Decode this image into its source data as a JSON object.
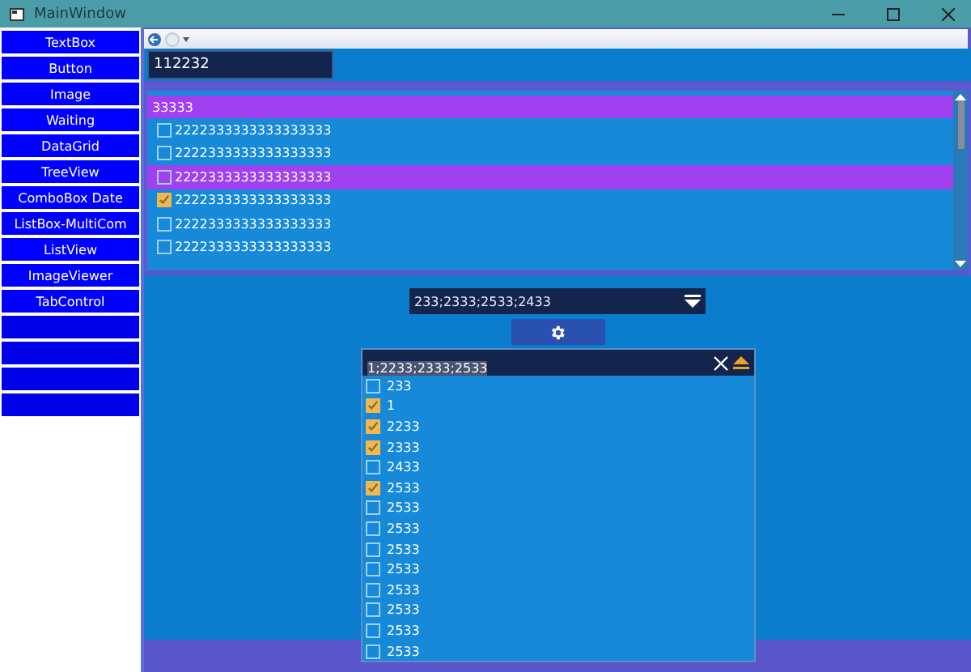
{
  "window": {
    "title": "MainWindow"
  },
  "sidebar": {
    "items": [
      {
        "label": "TextBox",
        "disabled": false
      },
      {
        "label": "Button",
        "disabled": false
      },
      {
        "label": "Image",
        "disabled": false
      },
      {
        "label": "Waiting",
        "disabled": false
      },
      {
        "label": "DataGrid",
        "disabled": false
      },
      {
        "label": "TreeView",
        "disabled": false
      },
      {
        "label": "ComboBox Date",
        "disabled": false
      },
      {
        "label": "ListBox-MultiCom",
        "disabled": false
      },
      {
        "label": "ListView",
        "disabled": false
      },
      {
        "label": "ImageViewer",
        "disabled": false
      },
      {
        "label": "TabControl",
        "disabled": false
      },
      {
        "disabled": true
      },
      {
        "disabled": true
      },
      {
        "disabled": true
      },
      {
        "disabled": true
      }
    ]
  },
  "textbox": {
    "value": "112232"
  },
  "list": {
    "header": "33333",
    "rows": [
      {
        "label": "2222333333333333333",
        "checked": false,
        "selected": false
      },
      {
        "label": "2222333333333333333",
        "checked": false,
        "selected": false
      },
      {
        "label": "2222333333333333333",
        "checked": false,
        "selected": true
      },
      {
        "label": "2222333333333333333",
        "checked": true,
        "selected": false
      },
      {
        "label": "2222333333333333333",
        "checked": false,
        "selected": false
      },
      {
        "label": "2222333333333333333",
        "checked": false,
        "selected": false
      }
    ]
  },
  "combo": {
    "value": "233;2333;2533;2433"
  },
  "multi_combo": {
    "value": "1;2233;2333;2533",
    "items": [
      {
        "label": "233",
        "checked": false
      },
      {
        "label": "1",
        "checked": true
      },
      {
        "label": "2233",
        "checked": true
      },
      {
        "label": "2333",
        "checked": true
      },
      {
        "label": "2433",
        "checked": false
      },
      {
        "label": "2533",
        "checked": true
      },
      {
        "label": "2533",
        "checked": false
      },
      {
        "label": "2533",
        "checked": false
      },
      {
        "label": "2533",
        "checked": false
      },
      {
        "label": "2533",
        "checked": false
      },
      {
        "label": "2533",
        "checked": false
      },
      {
        "label": "2533",
        "checked": false
      },
      {
        "label": "2533",
        "checked": false
      },
      {
        "label": "2533",
        "checked": false
      }
    ]
  }
}
